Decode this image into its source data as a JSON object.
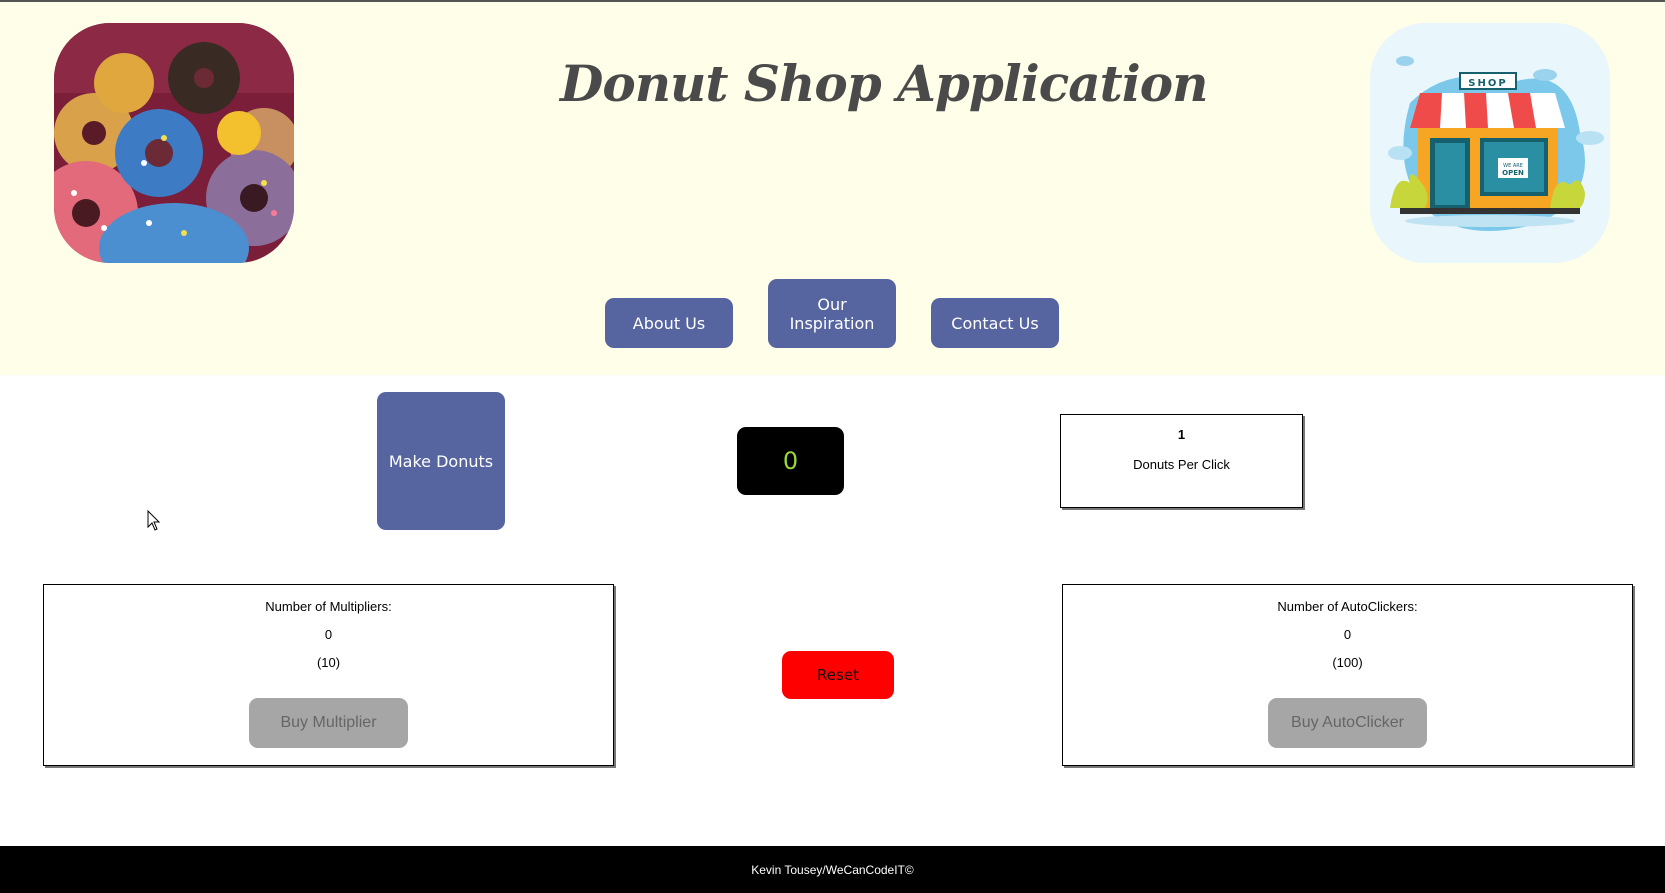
{
  "header": {
    "title": "Donut Shop Application",
    "shop_sign": "SHOP",
    "open_sign_1": "WE ARE",
    "open_sign_2": "OPEN"
  },
  "nav": {
    "about": "About Us",
    "inspiration_line1": "Our",
    "inspiration_line2": "Inspiration",
    "contact": "Contact Us"
  },
  "game": {
    "make_button": "Make Donuts",
    "donut_count": "0",
    "per_click_value": "1",
    "per_click_label": "Donuts Per Click",
    "reset_button": "Reset"
  },
  "multiplier": {
    "label": "Number of Multipliers:",
    "count": "0",
    "cost": "(10)",
    "button": "Buy Multiplier"
  },
  "autoclicker": {
    "label": "Number of AutoClickers:",
    "count": "0",
    "cost": "(100)",
    "button": "Buy AutoClicker"
  },
  "footer": {
    "credit": "Kevin Tousey/WeCanCodeIT©"
  },
  "colors": {
    "header_bg": "#fefee9",
    "button_blue": "#5664a0",
    "counter_text": "#9bd63b",
    "reset_red": "#ff0000",
    "disabled_gray": "#a6a6a6"
  }
}
